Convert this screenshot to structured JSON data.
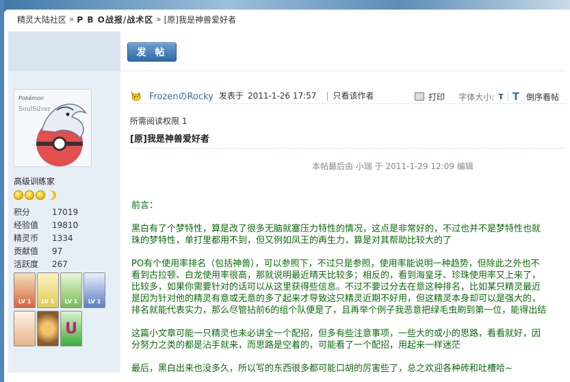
{
  "breadcrumb": {
    "items": [
      "精灵大陆社区",
      "P B O战报/战术区",
      "[原]我是神兽爱好者"
    ],
    "separator": "»"
  },
  "toolbar": {
    "post_label": "发 帖"
  },
  "user": {
    "avatar_text_top": "Pokémon",
    "avatar_text_sub": "SoulSilver",
    "title": "高级训练家",
    "stats": [
      {
        "label": "积分",
        "value": "17019"
      },
      {
        "label": "经验值",
        "value": "19810"
      },
      {
        "label": "精灵币",
        "value": "1334"
      },
      {
        "label": "贡献值",
        "value": "97"
      },
      {
        "label": "活跃度",
        "value": "267"
      }
    ],
    "medals": [
      {
        "label": "LV 1",
        "color": "#d8653c"
      },
      {
        "label": "LV 1",
        "color": "#e2cd58"
      },
      {
        "label": "LV 1",
        "color": "#79bb55"
      },
      {
        "label": "LV 1",
        "color": "#5c7fc8"
      },
      {
        "label": "",
        "color": "#e8b48a"
      },
      {
        "label": "",
        "color": "#8a5a2a"
      },
      {
        "label": "U",
        "color": "#3fae3a"
      }
    ]
  },
  "post": {
    "author": "FrozenのRocky",
    "posted_label": "发表于",
    "posted_time": "2011-1-26 17:57",
    "only_author": "只看该作者",
    "tools": {
      "print": "打印",
      "font_size_label": "字体大小:",
      "font_small": "T",
      "font_big": "T",
      "reverse": "倒序看帖"
    },
    "read_permission": "所需阅读权限 1",
    "title": "[原]我是神兽爱好者",
    "edit_note": "本帖最后由 小瑞 于 2011-1-29 12:09 编辑",
    "preface": "前言：",
    "paragraphs": [
      [
        "黑白有了个梦特性，算是改了很多无脑就塞压力特性的情况，这点是非常好的，不过也并不是梦特性也就",
        "珠的梦特性，单打里都用不到，但又例如凤王的再生力，算是对其帮助比较大的了"
      ],
      [
        "PO有个使用率排名（包括神兽），可以参照下，不过只是参照，使用率能说明一种趋势，但除此之外也不",
        "看到古拉顿、白龙使用率很高，那就说明最近晴天比较多；相反的，看到海皇牙、珍珠使用率又上来了，",
        "比较多，如果你需要针对的话可以从这里获得些信息。不过不要过分去在意这种排名，比如某只精灵最近",
        "是因为针对他的精灵有意或无意的多了起来才导致这只精灵近期不好用，但这精灵本身却可以是强大的，",
        "排名就能代表实力，那么尽管拈前6的组个队便是了，且再举个例子我恶意把绿毛虫刷到第一位，能得出结"
      ],
      [
        "这篇小文章可能一只精灵也未必讲全一个配招，但多有些注意事项，一些大的或小的思路，看看就好，因",
        "分努力之类的都是沾手就来，而思路是空着的，可能看了一个配招，用起来一样迷茫"
      ],
      [
        "最后，黑白出来也没多久，所以写的东西很多都可能口胡的厉害些了，总之欢迎各种砖和吐槽哈~"
      ]
    ]
  },
  "colors": {
    "link": "#2f6fab",
    "body_text": "#0b6b0b",
    "sidebar_bg": "#e6eef6",
    "button": "#2f6aa8"
  }
}
